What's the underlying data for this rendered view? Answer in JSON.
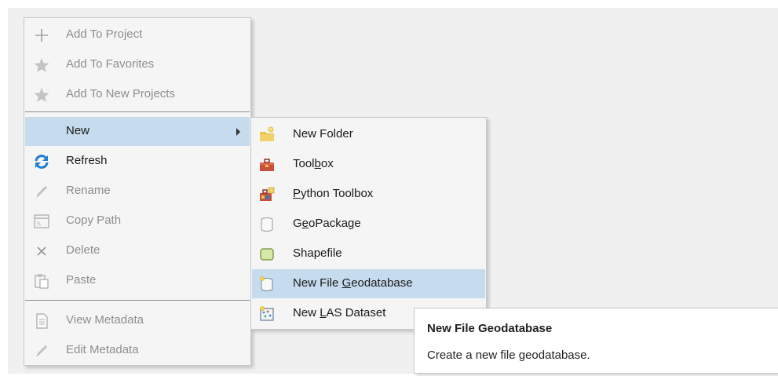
{
  "context_menu": {
    "items": [
      {
        "label": "Add To Project",
        "icon": "plus-icon",
        "enabled": false
      },
      {
        "label": "Add To Favorites",
        "icon": "star-icon",
        "enabled": false
      },
      {
        "label": "Add To New Projects",
        "icon": "star-icon",
        "enabled": false
      },
      {
        "label": "New",
        "icon": "",
        "enabled": true,
        "highlighted": true,
        "has_submenu": true
      },
      {
        "label": "Refresh",
        "icon": "refresh-icon",
        "enabled": true
      },
      {
        "label": "Rename",
        "icon": "pencil-icon",
        "enabled": false
      },
      {
        "label": "Copy Path",
        "icon": "copy-path-icon",
        "enabled": false
      },
      {
        "label": "Delete",
        "icon": "x-icon",
        "enabled": false
      },
      {
        "label": "Paste",
        "icon": "clipboard-icon",
        "enabled": false
      },
      {
        "label": "View Metadata",
        "icon": "document-icon",
        "enabled": false
      },
      {
        "label": "Edit Metadata",
        "icon": "pencil-icon",
        "enabled": false
      }
    ]
  },
  "new_submenu": {
    "items": [
      {
        "label": "New Folder",
        "pre": "New Folder",
        "mn": "",
        "post": "",
        "icon": "new-folder-icon"
      },
      {
        "label": "Toolbox",
        "pre": "Tool",
        "mn": "b",
        "post": "ox",
        "icon": "toolbox-icon"
      },
      {
        "label": "Python Toolbox",
        "pre": "",
        "mn": "P",
        "post": "ython Toolbox",
        "icon": "python-toolbox-icon"
      },
      {
        "label": "GeoPackage",
        "pre": "G",
        "mn": "e",
        "post": "oPackage",
        "icon": "geopackage-icon"
      },
      {
        "label": "Shapefile",
        "pre": "Shapefile",
        "mn": "",
        "post": "",
        "icon": "shapefile-icon"
      },
      {
        "label": "New File Geodatabase",
        "pre": "New File ",
        "mn": "G",
        "post": "eodatabase",
        "icon": "file-geodatabase-icon",
        "highlighted": true
      },
      {
        "label": "New LAS Dataset",
        "pre": "New ",
        "mn": "L",
        "post": "AS Dataset",
        "icon": "las-dataset-icon"
      }
    ]
  },
  "tooltip": {
    "title": "New File Geodatabase",
    "description": "Create a new file geodatabase."
  },
  "colors": {
    "highlight": "#c6dbee",
    "disabled_text": "#8e8e8e",
    "refresh_blue": "#1e7fd4",
    "menu_bg": "#f5f5f5"
  }
}
